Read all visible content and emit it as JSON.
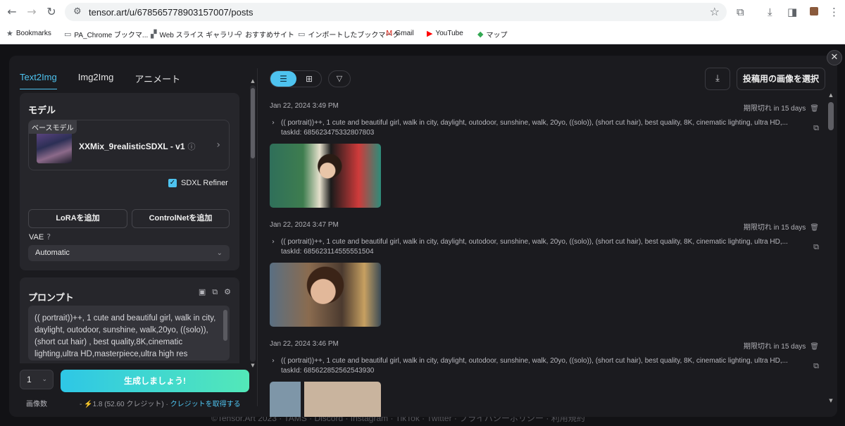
{
  "browser": {
    "url": "tensor.art/u/678565778903157007/posts",
    "bookmarks": [
      "Bookmarks",
      "PA_Chrome ブックマ...",
      "Web スライス ギャラリー",
      "おすすめサイト",
      "インポートしたブックマーク",
      "Gmail",
      "YouTube",
      "マップ"
    ]
  },
  "footer_bg": "©Tensor.Art 2023 · TAMS · Discord · Instagram · TikTok · Twitter · プライバシーポリシー · 利用規約",
  "left": {
    "tabs": [
      "Text2Img",
      "Img2Img",
      "アニメート"
    ],
    "model_section": {
      "title": "モデル",
      "base_tag": "ベースモデル",
      "model_name": "XXMix_9realisticSDXL - v1",
      "refiner_label": "SDXL Refiner",
      "lora_button": "LoRAを追加",
      "controlnet_button": "ControlNetを追加",
      "vae_label": "VAE",
      "vae_value": "Automatic"
    },
    "prompt_section": {
      "title": "プロンプト",
      "text": "(( portrait))++, 1 cute and beautiful  girl, walk in city, daylight, outodoor, sunshine, walk,20yo, ((solo)), (short cut hair) , best quality,8K,cinematic lighting,ultra HD,masterpiece,ultra high res"
    },
    "image_count": "1",
    "generate_button": "生成しましょう!",
    "image_count_label": "画像数",
    "credit": {
      "cost": "1.8",
      "balance": "(52.60 クレジット)",
      "link": "クレジットを取得する"
    }
  },
  "right": {
    "select_post_button": "投稿用の画像を選択",
    "entries": [
      {
        "date": "Jan 22, 2024 3:49 PM",
        "expire": "期限切れ in 15 days",
        "prompt": "(( portrait))++, 1 cute and beautiful girl, walk in city, daylight, outodoor, sunshine, walk, 20yo, ((solo)), (short cut hair), best quality, 8K, cinematic lighting, ultra HD,...",
        "task_id": "taskId: 685623475332807803"
      },
      {
        "date": "Jan 22, 2024 3:47 PM",
        "expire": "期限切れ in 15 days",
        "prompt": "(( portrait))++, 1 cute and beautiful girl, walk in city, daylight, outodoor, sunshine, walk, 20yo, ((solo)), (short cut hair), best quality, 8K, cinematic lighting, ultra HD,...",
        "task_id": "taskId: 685623114555551504"
      },
      {
        "date": "Jan 22, 2024 3:46 PM",
        "expire": "期限切れ in 15 days",
        "prompt": "(( portrait))++, 1 cute and beautiful girl, walk in city, daylight, outodoor, sunshine, walk, 20yo, ((solo)), (short cut hair), best quality, 8K, cinematic lighting, ultra HD,...",
        "task_id": "taskId: 685622852562543930"
      }
    ]
  },
  "colors": {
    "accent": "#4ec3ef",
    "gradient_start": "#2ec7e6",
    "gradient_end": "#53e8b8",
    "panel": "#26262b"
  }
}
